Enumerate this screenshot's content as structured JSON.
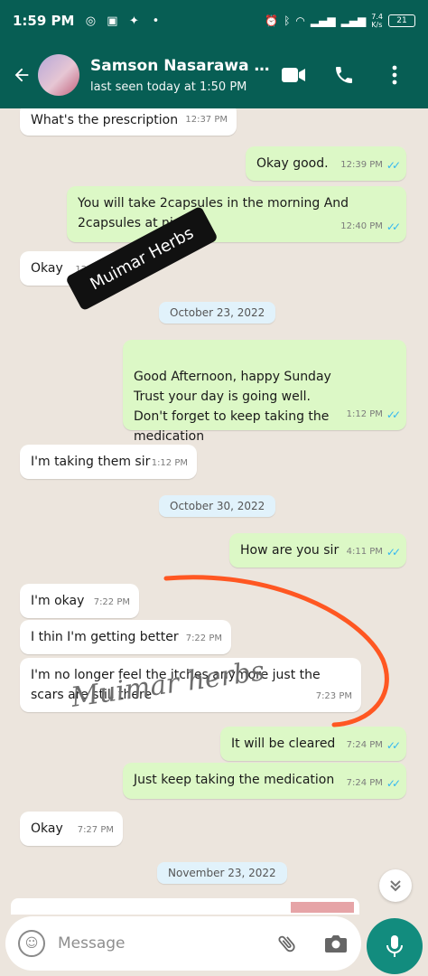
{
  "status_bar": {
    "time": "1:59 PM",
    "net_speed": "7.4",
    "net_unit": "K/s",
    "battery": "21"
  },
  "header": {
    "contact_name": "Samson Nasarawa M...",
    "last_seen": "last seen today at 1:50 PM"
  },
  "messages": [
    {
      "dir": "in",
      "text": "What's the prescription",
      "time": "12:37 PM"
    },
    {
      "dir": "out",
      "text": "Okay good.",
      "time": "12:39 PM"
    },
    {
      "dir": "out",
      "text": "You will take 2capsules in the morning And 2capsules at night",
      "time": "12:40 PM"
    },
    {
      "dir": "in",
      "text": "Okay",
      "time": "12:40 PM"
    },
    {
      "dir": "out",
      "text": "Good Afternoon, happy Sunday\nTrust your day is going well.\nDon't forget to keep taking the medication",
      "time": "1:12 PM"
    },
    {
      "dir": "in",
      "text": "I'm taking them sir",
      "time": "1:12 PM"
    },
    {
      "dir": "out",
      "text": "How are you sir",
      "time": "4:11 PM"
    },
    {
      "dir": "in",
      "text": "I'm okay",
      "time": "7:22 PM"
    },
    {
      "dir": "in",
      "text": "I thin I'm getting better",
      "time": "7:22 PM"
    },
    {
      "dir": "in",
      "text": "I'm no longer feel the itches anymore just the scars are still there",
      "time": "7:23 PM"
    },
    {
      "dir": "out",
      "text": "It will be cleared",
      "time": "7:24 PM"
    },
    {
      "dir": "out",
      "text": "Just keep taking the medication",
      "time": "7:24 PM"
    },
    {
      "dir": "in",
      "text": "Okay",
      "time": "7:27 PM"
    }
  ],
  "date_chips": [
    "October 23, 2022",
    "October 30, 2022",
    "November 23, 2022"
  ],
  "watermarks": [
    "Muimar Herbs",
    "Muimar herbs"
  ],
  "composer": {
    "placeholder": "Message"
  },
  "colors": {
    "header": "#075e54",
    "incoming": "#ffffff",
    "outgoing": "#dcf8c6",
    "read_ticks": "#34b7f1",
    "mic": "#128c7e",
    "annotation": "#ff5722"
  }
}
